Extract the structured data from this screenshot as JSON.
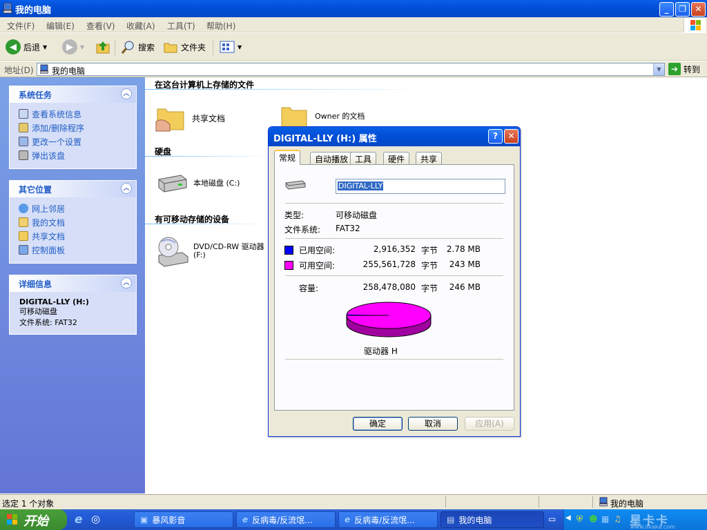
{
  "window": {
    "title": "我的电脑"
  },
  "menu": [
    "文件(F)",
    "编辑(E)",
    "查看(V)",
    "收藏(A)",
    "工具(T)",
    "帮助(H)"
  ],
  "toolbar": {
    "back": "后退",
    "search": "搜索",
    "folders": "文件夹"
  },
  "address": {
    "label": "地址(D)",
    "value": "我的电脑",
    "go": "转到"
  },
  "left": {
    "system_tasks": {
      "title": "系统任务",
      "items": [
        "查看系统信息",
        "添加/删除程序",
        "更改一个设置",
        "弹出该盘"
      ]
    },
    "other_places": {
      "title": "其它位置",
      "items": [
        "网上邻居",
        "我的文档",
        "共享文档",
        "控制面板"
      ]
    },
    "details": {
      "title": "详细信息",
      "name": "DIGITAL-LLY (H:)",
      "type": "可移动磁盘",
      "fs": "文件系统: FAT32"
    }
  },
  "main": {
    "group_files": "在这台计算机上存储的文件",
    "shared_docs": "共享文档",
    "owner_docs": "Owner 的文档",
    "group_hdd": "硬盘",
    "local_disk": "本地磁盘 (C:)",
    "group_removable": "有可移动存储的设备",
    "dvd_1": "DVD/CD-RW 驱动器",
    "dvd_2": "(F:)"
  },
  "dialog": {
    "title": "DIGITAL-LLY (H:) 属性",
    "tabs": [
      "常规",
      "自动播放",
      "工具",
      "硬件",
      "共享"
    ],
    "label_value": "DIGITAL-LLY",
    "type_label": "类型:",
    "type_value": "可移动磁盘",
    "fs_label": "文件系统:",
    "fs_value": "FAT32",
    "used": {
      "label": "已用空间:",
      "bytes": "2,916,352",
      "unit": "字节",
      "size": "2.78 MB",
      "color": "#0000ff"
    },
    "free": {
      "label": "可用空间:",
      "bytes": "255,561,728",
      "unit": "字节",
      "size": "243 MB",
      "color": "#ff00ff"
    },
    "capacity": {
      "label": "容量:",
      "bytes": "258,478,080",
      "unit": "字节",
      "size": "246 MB"
    },
    "drive_label": "驱动器 H",
    "used_fraction": 0.0113,
    "buttons": {
      "ok": "确定",
      "cancel": "取消",
      "apply": "应用(A)"
    }
  },
  "status": {
    "left": "选定 1 个对象",
    "right": "我的电脑"
  },
  "taskbar": {
    "start": "开始",
    "tasks": [
      "暴风影音",
      "反病毒/反流氓...",
      "反病毒/反流氓...",
      "我的电脑"
    ],
    "watermark_1": "星卡卡",
    "watermark_2": "www.ifkaka.com"
  }
}
